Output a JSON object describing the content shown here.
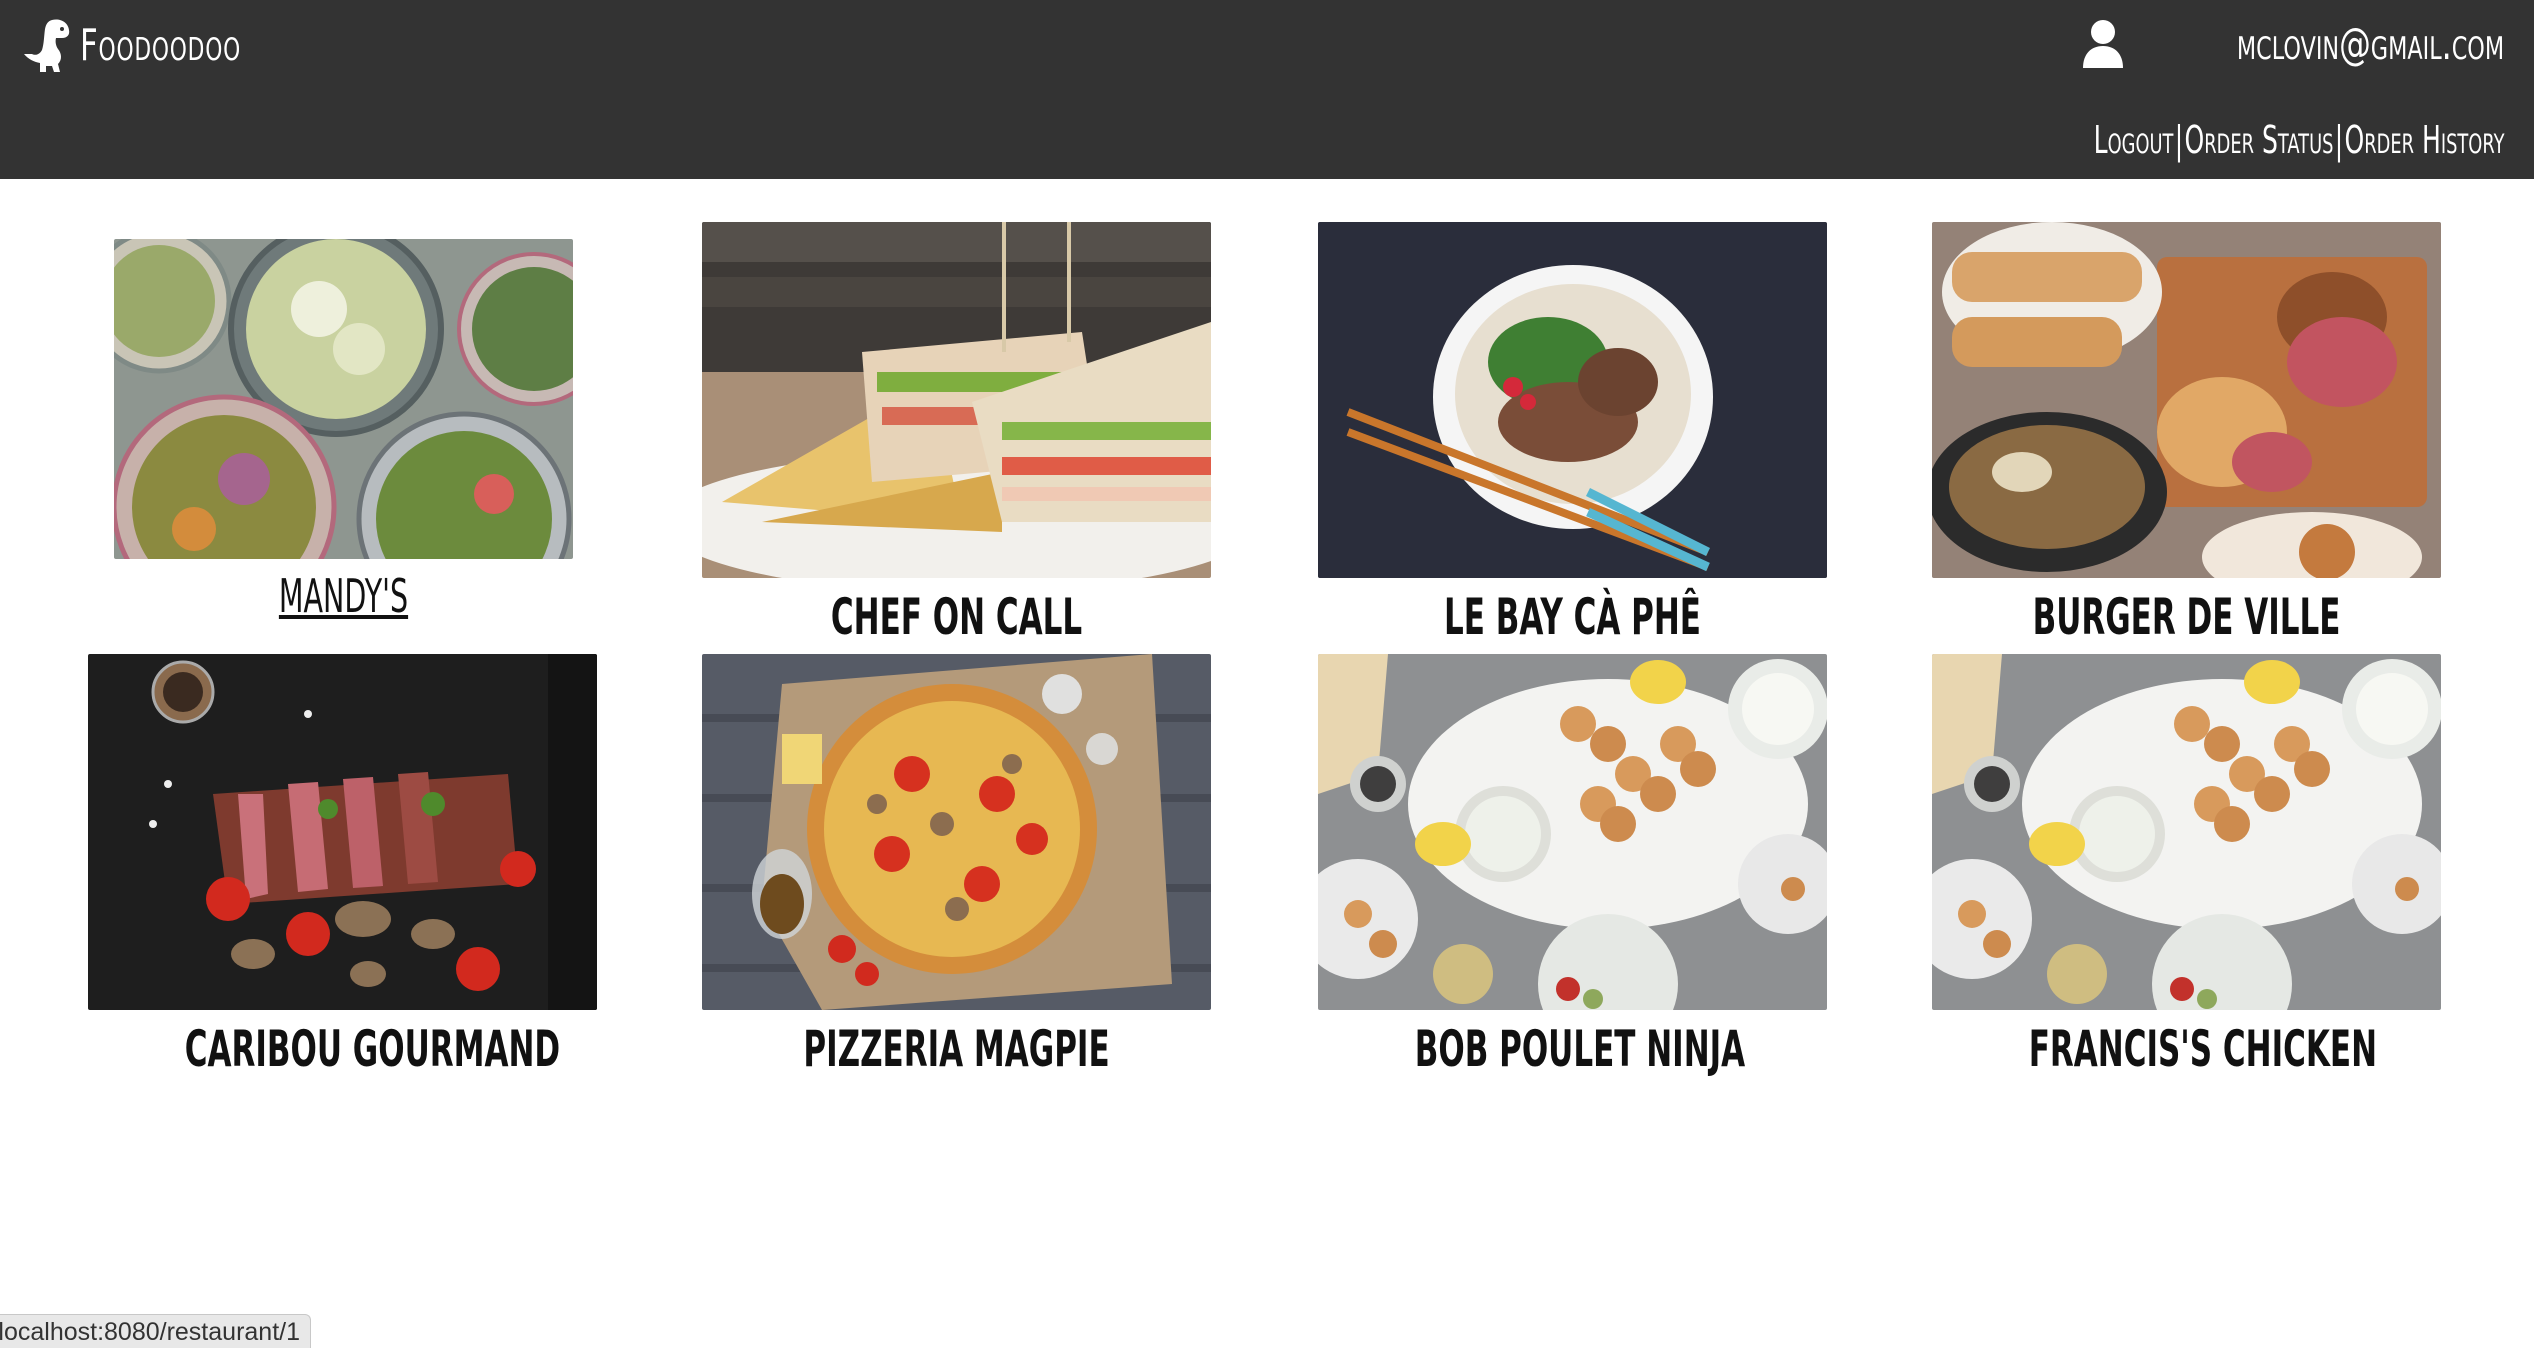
{
  "header": {
    "brand_name": "Foodoodoo",
    "user_email": "mclovin@gmail.com",
    "nav": {
      "logout": "Logout",
      "separator_1": "|",
      "order_status": "Order Status",
      "separator_2": "|",
      "order_history": "Order History"
    }
  },
  "restaurants": [
    {
      "name": "MANDY'S"
    },
    {
      "name": "CHEF ON CALL"
    },
    {
      "name": "LE BAY CÀ PHÊ"
    },
    {
      "name": "BURGER DE VILLE"
    },
    {
      "name": "CARIBOU GOURMAND"
    },
    {
      "name": "PIZZERIA MAGPIE"
    },
    {
      "name": "BOB POULET NINJA"
    },
    {
      "name": "FRANCIS'S CHICKEN"
    }
  ],
  "status_bar": {
    "url": "localhost:8080/restaurant/1"
  },
  "colors": {
    "header_bg": "#333333",
    "header_text": "#ffffff",
    "page_bg": "#ffffff"
  },
  "icons": {
    "brand": "dinosaur-logo-icon",
    "user": "user-icon"
  }
}
